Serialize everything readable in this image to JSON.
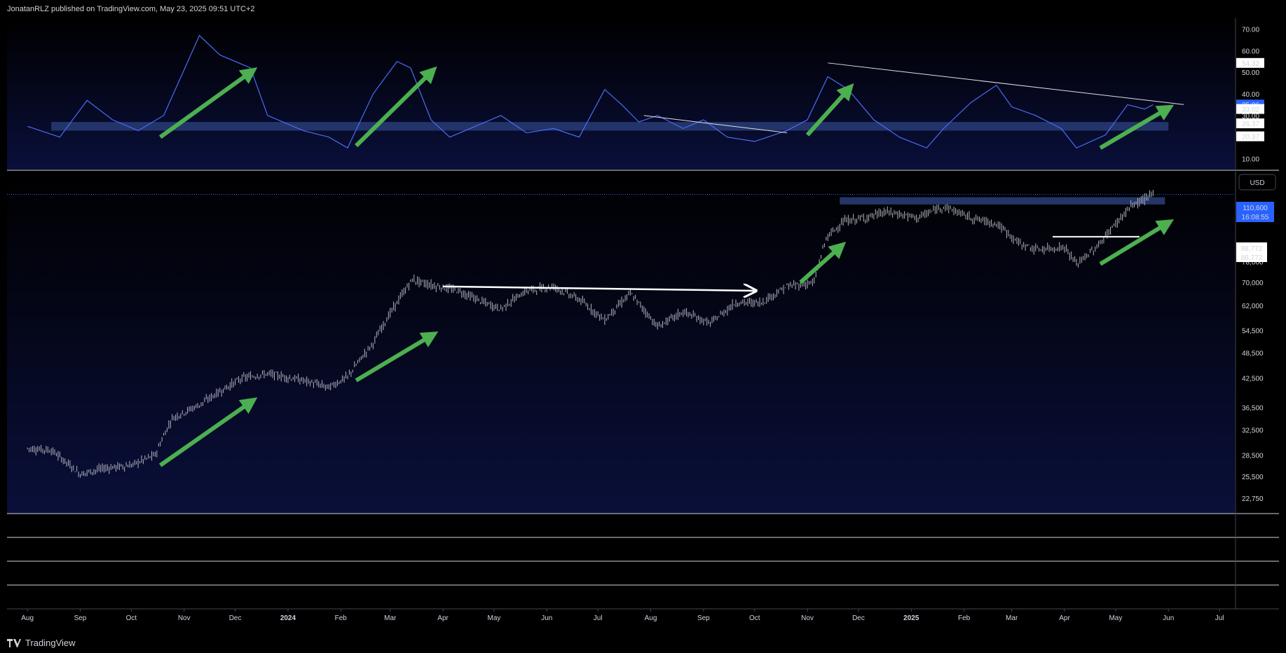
{
  "header": {
    "publish_text": "JonatanRLZ published on TradingView.com, May 23, 2025 09:51 UTC+2"
  },
  "footer": {
    "brand": "TradingView",
    "logo_icon": "tradingview-logo-icon"
  },
  "price_panel": {
    "currency_button": "USD",
    "last_price_label": "110,600",
    "countdown_label": "16:08:55",
    "level_labels": [
      "88,772",
      "88,772"
    ],
    "colors": {
      "accent": "#2962ff",
      "background_top": "#000000",
      "background_bottom": "#0a0f3a",
      "candle": "#b2b5be",
      "arrow": "#4caf50",
      "zone": "#2a3f7a"
    }
  },
  "chart_data": [
    {
      "type": "line",
      "name": "oscillator",
      "ylim": [
        5,
        75
      ],
      "y_ticks": [
        "70.00",
        "60.00",
        "50.00",
        "40.00",
        "30.00",
        "20.00",
        "10.00"
      ],
      "value_labels": [
        "54.32",
        "35.06",
        "33.02",
        "26.37",
        "20.37"
      ],
      "highlighted_value": "35.06",
      "x": [
        "2023-08-01",
        "2023-08-20",
        "2023-09-05",
        "2023-09-20",
        "2023-10-05",
        "2023-10-20",
        "2023-11-10",
        "2023-11-22",
        "2023-12-10",
        "2023-12-20",
        "2024-01-10",
        "2024-01-25",
        "2024-02-05",
        "2024-02-20",
        "2024-03-05",
        "2024-03-13",
        "2024-03-25",
        "2024-04-05",
        "2024-04-20",
        "2024-05-05",
        "2024-05-20",
        "2024-06-05",
        "2024-06-20",
        "2024-07-05",
        "2024-07-15",
        "2024-07-25",
        "2024-08-05",
        "2024-08-20",
        "2024-09-01",
        "2024-09-15",
        "2024-10-01",
        "2024-10-20",
        "2024-11-01",
        "2024-11-13",
        "2024-11-25",
        "2024-12-10",
        "2024-12-25",
        "2025-01-10",
        "2025-01-20",
        "2025-02-05",
        "2025-02-20",
        "2025-03-01",
        "2025-03-15",
        "2025-03-30",
        "2025-04-08",
        "2025-04-25",
        "2025-05-08",
        "2025-05-18",
        "2025-05-23"
      ],
      "y": [
        25,
        20,
        37,
        28,
        23,
        30,
        67,
        58,
        52,
        30,
        23,
        20,
        15,
        40,
        55,
        52,
        28,
        20,
        25,
        30,
        22,
        24,
        20,
        42,
        35,
        27,
        30,
        24,
        28,
        20,
        18,
        23,
        28,
        48,
        42,
        28,
        20,
        15,
        24,
        36,
        44,
        34,
        30,
        24,
        15,
        21,
        35,
        33,
        35
      ],
      "zone": [
        23,
        27
      ],
      "trendlines": [
        {
          "from": [
            "2024-11-13",
            54.32
          ],
          "to": [
            "2025-06-10",
            35.06
          ]
        },
        {
          "from": [
            "2024-07-28",
            30
          ],
          "to": [
            "2024-10-20",
            22
          ]
        }
      ]
    },
    {
      "type": "bar",
      "name": "BTCUSD",
      "scale": "log",
      "ylim": [
        21000,
        125000
      ],
      "y_ticks": [
        "78,000",
        "70,000",
        "62,000",
        "54,500",
        "48,500",
        "42,500",
        "36,500",
        "32,500",
        "28,500",
        "25,500",
        "22,750"
      ],
      "x_labels": [
        "Aug",
        "Sep",
        "Oct",
        "Nov",
        "Dec",
        "2024",
        "Feb",
        "Mar",
        "Apr",
        "May",
        "Jun",
        "Jul",
        "Aug",
        "Sep",
        "Oct",
        "Nov",
        "Dec",
        "2025",
        "Feb",
        "Mar",
        "Apr",
        "May",
        "Jun",
        "Jul"
      ],
      "x_bold": [
        "2024",
        "2025"
      ],
      "x": [
        "2023-08-01",
        "2023-08-15",
        "2023-09-01",
        "2023-09-15",
        "2023-10-01",
        "2023-10-15",
        "2023-10-25",
        "2023-11-10",
        "2023-12-05",
        "2023-12-20",
        "2024-01-10",
        "2024-01-25",
        "2024-02-05",
        "2024-02-20",
        "2024-03-05",
        "2024-03-14",
        "2024-03-25",
        "2024-04-10",
        "2024-04-25",
        "2024-05-05",
        "2024-05-20",
        "2024-06-05",
        "2024-06-20",
        "2024-07-05",
        "2024-07-20",
        "2024-08-05",
        "2024-08-20",
        "2024-09-05",
        "2024-09-20",
        "2024-10-05",
        "2024-10-20",
        "2024-11-05",
        "2024-11-12",
        "2024-11-22",
        "2024-12-05",
        "2024-12-17",
        "2025-01-05",
        "2025-01-20",
        "2025-02-05",
        "2025-02-20",
        "2025-03-05",
        "2025-03-15",
        "2025-04-01",
        "2025-04-08",
        "2025-04-20",
        "2025-05-01",
        "2025-05-10",
        "2025-05-23"
      ],
      "y": [
        29500,
        29200,
        25800,
        26600,
        27000,
        28500,
        34500,
        37000,
        42500,
        43500,
        42000,
        40500,
        42800,
        51000,
        63000,
        71000,
        69000,
        67000,
        63000,
        61000,
        67000,
        68500,
        64000,
        57500,
        66000,
        55500,
        60000,
        56500,
        63000,
        63000,
        68500,
        70000,
        88000,
        96000,
        98000,
        101000,
        98000,
        104000,
        98000,
        95000,
        86000,
        83000,
        84000,
        77000,
        84000,
        95000,
        104000,
        110600
      ],
      "zone": [
        105000,
        109000
      ],
      "level": 88772,
      "trendlines": [
        {
          "from": [
            "2024-04-01",
            68500
          ],
          "to": [
            "2024-10-01",
            67000
          ]
        }
      ],
      "arrows": [
        {
          "from": [
            "2023-10-18",
            27000
          ],
          "to": [
            "2023-12-10",
            37500
          ]
        },
        {
          "from": [
            "2024-02-10",
            42000
          ],
          "to": [
            "2024-03-25",
            53000
          ]
        },
        {
          "from": [
            "2024-10-28",
            70000
          ],
          "to": [
            "2024-11-20",
            84000
          ]
        },
        {
          "from": [
            "2025-04-22",
            77000
          ],
          "to": [
            "2025-05-31",
            95000
          ]
        }
      ]
    }
  ]
}
